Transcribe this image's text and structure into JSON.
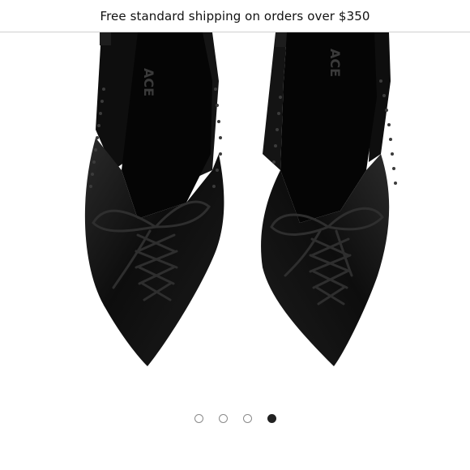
{
  "promo": {
    "text": "Free standard shipping on orders over $350"
  },
  "product_image": {
    "brand_mark": "ACE",
    "description_icon": "black-satin-lace-up-slingback-pumps"
  },
  "carousel": {
    "dots": [
      {
        "label": "slide-1",
        "active": false
      },
      {
        "label": "slide-2",
        "active": false
      },
      {
        "label": "slide-3",
        "active": false
      },
      {
        "label": "slide-4",
        "active": true
      }
    ]
  },
  "colors": {
    "shoe": "#111111",
    "accent": "#222222",
    "dot_inactive": "#8a8a8a"
  }
}
